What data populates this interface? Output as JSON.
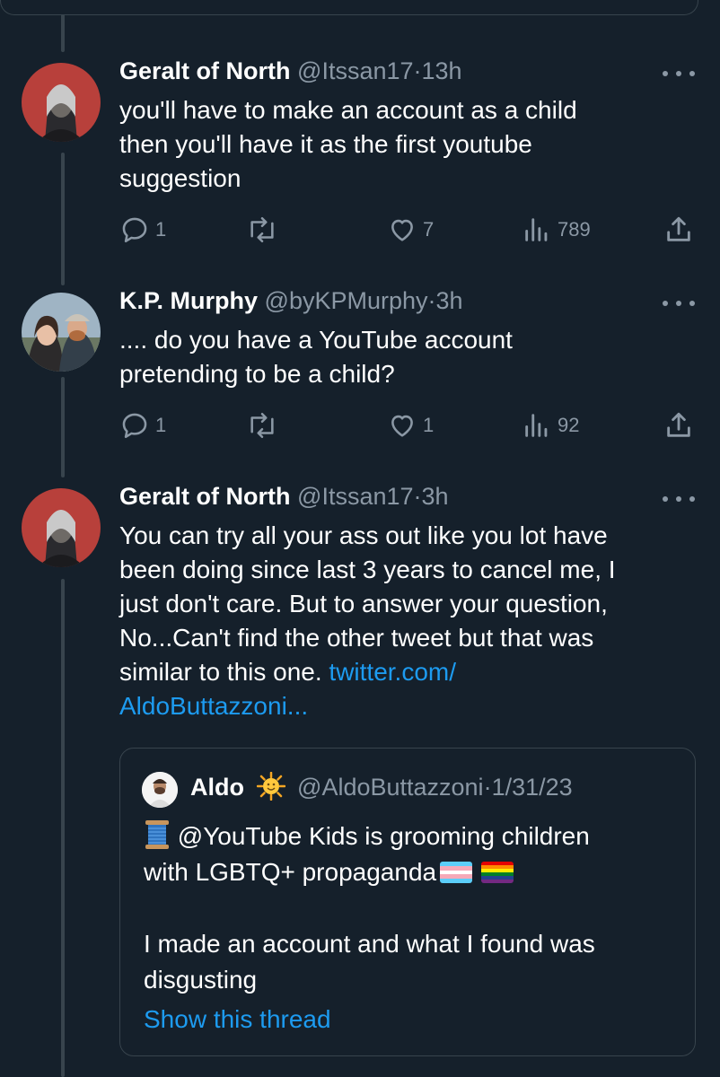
{
  "tweets": [
    {
      "name": "Geralt of North",
      "handle": "@Itssan17",
      "dot": "·",
      "time": "13h",
      "lines": [
        "you'll have to make an account as a child",
        "then you'll have it as the first youtube",
        "suggestion"
      ],
      "replies": "1",
      "retweets": "",
      "likes": "7",
      "views": "789"
    },
    {
      "name": "K.P. Murphy",
      "handle": "@byKPMurphy",
      "dot": "·",
      "time": "3h",
      "lines": [
        ".... do you have a YouTube account",
        "pretending to be a child?"
      ],
      "replies": "1",
      "retweets": "",
      "likes": "1",
      "views": "92"
    },
    {
      "name": "Geralt of North",
      "handle": "@Itssan17",
      "dot": "·",
      "time": "3h",
      "lines": [
        "You can try all your ass out like you lot have",
        "been doing since last 3 years to cancel me, I",
        "just don't care. But to answer your question,",
        "No...Can't find the other tweet but that was",
        "similar to this one. "
      ],
      "link_part1": "twitter.com/",
      "link_part2": "AldoButtazzoni..."
    }
  ],
  "quote": {
    "name": "Aldo",
    "name_emoji": "sun-face",
    "handle": "@AldoButtazzoni",
    "dot": "·",
    "time": "1/31/23",
    "thread_emoji": "spool-of-thread",
    "line1": " @YouTube Kids is grooming children",
    "line2": "with LGBTQ+ propaganda",
    "line3": "I made an account and what I found was",
    "line4": "disgusting",
    "show_thread": "Show this thread"
  },
  "colors": {
    "background": "#15202b",
    "border": "#38444d",
    "secondary_text": "#8b98a5",
    "link": "#1d9bf0"
  },
  "icons": [
    "reply-icon",
    "retweet-icon",
    "like-icon",
    "views-icon",
    "share-icon",
    "more-icon"
  ]
}
